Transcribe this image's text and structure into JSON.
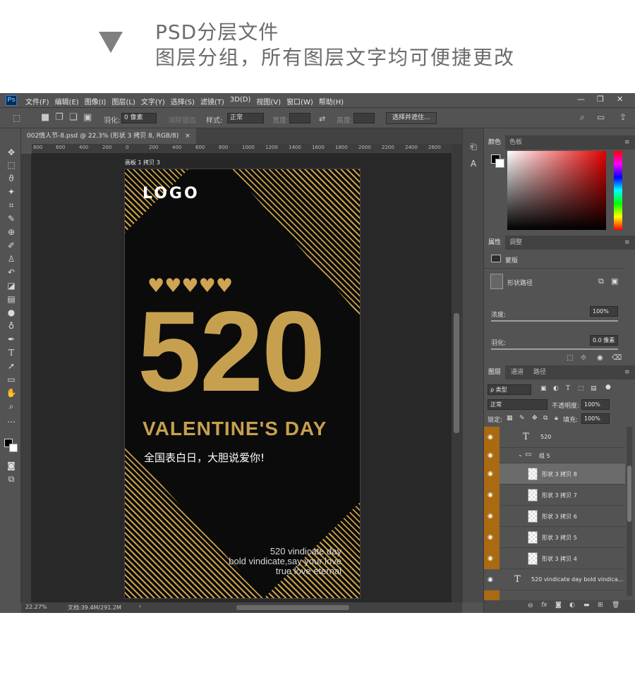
{
  "banner": {
    "line1": "PSD分层文件",
    "line2": "图层分组，所有图层文字均可便捷更改"
  },
  "app": {
    "logo": "Ps",
    "menu": [
      "文件(F)",
      "编辑(E)",
      "图像(I)",
      "图层(L)",
      "文字(Y)",
      "选择(S)",
      "滤镜(T)",
      "3D(D)",
      "视图(V)",
      "窗口(W)",
      "帮助(H)"
    ],
    "window_controls": [
      "—",
      "❐",
      "✕"
    ]
  },
  "options": {
    "feather_label": "羽化:",
    "feather_value": "0 像素",
    "antialias_label": "消除锯齿",
    "style_label": "样式:",
    "style_value": "正常",
    "width_label": "宽度:",
    "height_label": "高度:",
    "select_mask_button": "选择并遮住..."
  },
  "document": {
    "tab_label": "002情人节-8.psd @ 22.3% (形状 3 拷贝 8, RGB/8)",
    "tab_close": "×",
    "artboard_label": "画板 1 拷贝 3",
    "zoom": "22.27%",
    "doc_info": "文档:39.4M/291.2M",
    "ruler_marks": [
      "800",
      "600",
      "400",
      "200",
      "0",
      "200",
      "400",
      "600",
      "800",
      "1000",
      "1200",
      "1400",
      "1600",
      "1800",
      "2000",
      "2200",
      "2400",
      "2600"
    ]
  },
  "artwork": {
    "logo": "LOGO",
    "hearts": "♥♥♥♥♥",
    "headline": "520",
    "title_en": "VALENTINE'S DAY",
    "subtitle_cn": "全国表白日，大胆说爱你!",
    "en_line1": "520 vindicate day",
    "en_line2": "bold vindicate,say your love",
    "en_line3": "true love eternal",
    "gold": "#c7a04f"
  },
  "color_panel": {
    "tabs": [
      "颜色",
      "色板"
    ]
  },
  "properties_panel": {
    "tabs": [
      "属性",
      "调整"
    ],
    "mask_label": "蒙版",
    "shape_path_label": "形状路径",
    "density_label": "浓度:",
    "density_value": "100%",
    "feather_label": "羽化:",
    "feather_value": "0.0 像素"
  },
  "layers_panel": {
    "tabs": [
      "图层",
      "通道",
      "路径"
    ],
    "filter_kind": "ρ 类型",
    "blend_mode": "正常",
    "opacity_label": "不透明度:",
    "opacity_value": "100%",
    "lock_label": "锁定:",
    "fill_label": "填充:",
    "fill_value": "100%",
    "accent": "#a96a11",
    "layers": [
      {
        "name": "520",
        "kind": "text"
      },
      {
        "name": "组 5",
        "kind": "group"
      },
      {
        "name": "形状 3 拷贝 8",
        "kind": "shape"
      },
      {
        "name": "形状 3 拷贝 7",
        "kind": "shape"
      },
      {
        "name": "形状 3 拷贝 6",
        "kind": "shape"
      },
      {
        "name": "形状 3 拷贝 5",
        "kind": "shape"
      },
      {
        "name": "形状 3 拷贝 4",
        "kind": "shape"
      },
      {
        "name": "520 vindicate day bold vindica...",
        "kind": "text"
      }
    ],
    "footer_icons": [
      "link-icon",
      "fx-icon",
      "mask-icon",
      "adjustment-icon",
      "folder-icon",
      "new-layer-icon",
      "trash-icon"
    ],
    "footer_fx": "fx"
  }
}
